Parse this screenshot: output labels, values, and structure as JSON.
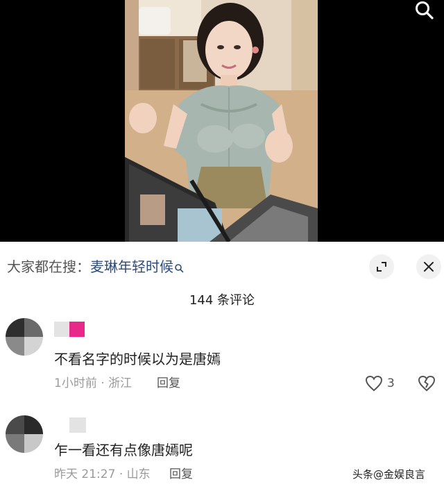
{
  "suggestion": {
    "prefix": "大家都在搜：",
    "query": "麦琳年轻时候"
  },
  "comments_header": {
    "count_label": "144 条评论"
  },
  "comments": [
    {
      "text": "不看名字的时候以为是唐嫣",
      "time": "1小时前",
      "location": "浙江",
      "reply_label": "回复",
      "likes": "3"
    },
    {
      "text": "乍一看还有点像唐嫣呢",
      "time": "昨天 21:27",
      "location": "山东",
      "reply_label": "回复"
    }
  ],
  "watermark": "头条@金娱良言",
  "meta_separator": "·",
  "icons": {
    "video_search": "search-icon",
    "suggestion": "search-small-icon",
    "expand": "expand-icon",
    "close": "close-icon",
    "like": "heart-icon",
    "dislike": "broken-heart-icon"
  },
  "colors": {
    "query_link": "#2b4d7e",
    "name_blur_pink": "#e8298a",
    "muted_text": "#9a9a9a"
  }
}
